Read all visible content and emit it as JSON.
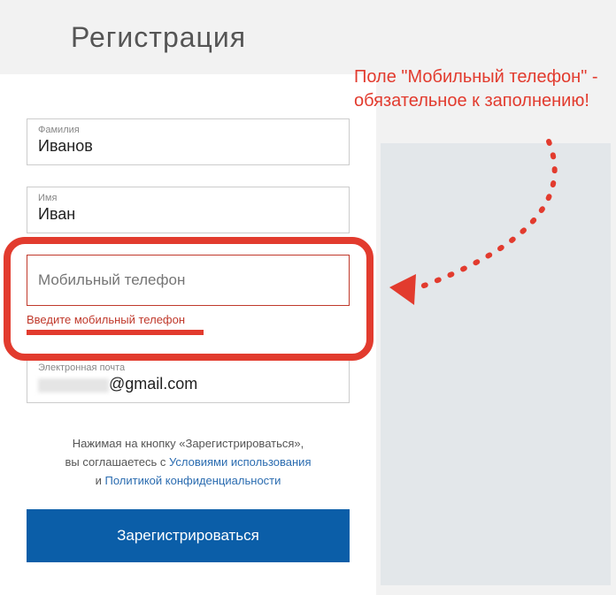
{
  "header": {
    "title": "Регистрация"
  },
  "fields": {
    "lastname": {
      "label": "Фамилия",
      "value": "Иванов"
    },
    "firstname": {
      "label": "Имя",
      "value": "Иван"
    },
    "phone": {
      "placeholder": "Мобильный телефон",
      "error": "Введите мобильный телефон"
    },
    "email": {
      "label": "Электронная почта",
      "value_suffix": "@gmail.com"
    }
  },
  "consent": {
    "line1_a": "Нажимая на кнопку «Зарегистрироваться»,",
    "line2_a": "вы соглашаетесь с ",
    "terms": "Условиями использования",
    "line3_a": "и ",
    "privacy": "Политикой конфиденциальности"
  },
  "button": {
    "register": "Зарегистрироваться"
  },
  "annotation": {
    "text": "Поле \"Мобильный телефон\" - обязательное к заполнению!"
  }
}
